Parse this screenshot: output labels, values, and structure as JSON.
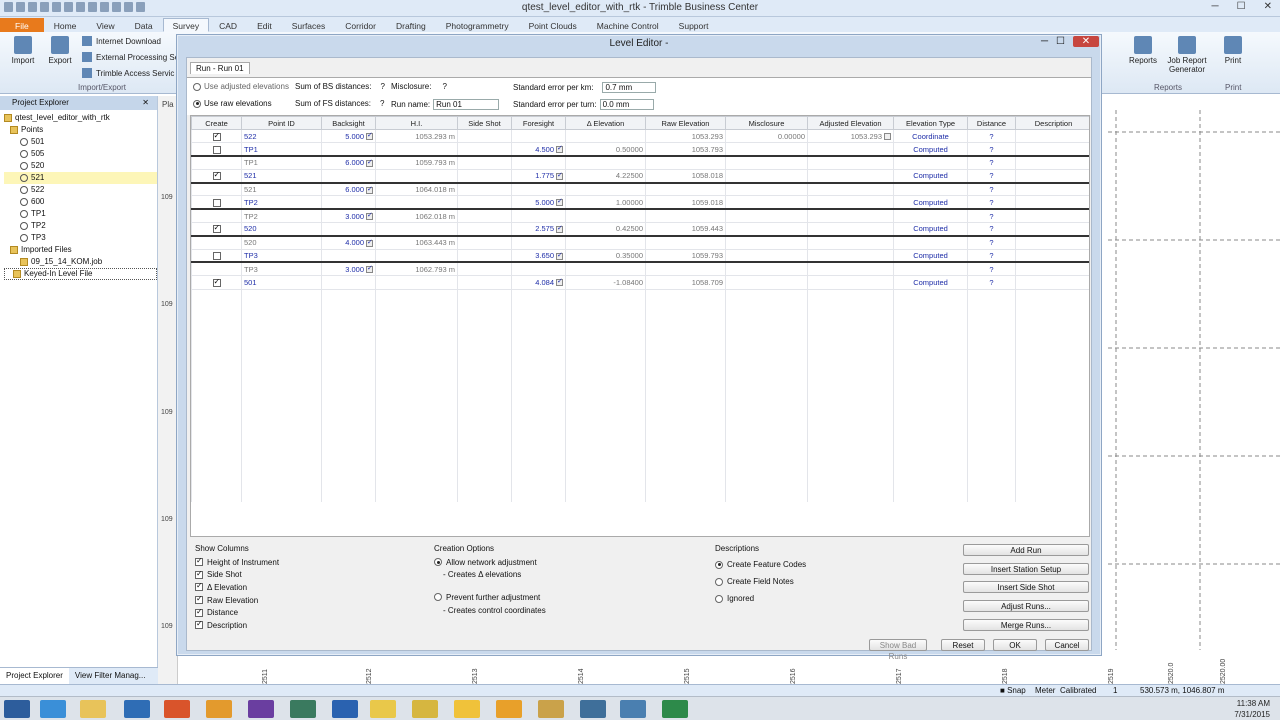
{
  "app": {
    "title": "qtest_level_editor_with_rtk - Trimble Business Center",
    "tabs": [
      "File",
      "Home",
      "View",
      "Data",
      "Survey",
      "CAD",
      "Edit",
      "Surfaces",
      "Corridor",
      "Drafting",
      "Photogrammetry",
      "Point Clouds",
      "Machine Control",
      "Support"
    ],
    "active_tab": "Survey"
  },
  "ribbon": {
    "import": "Import",
    "export": "Export",
    "internet_download": "Internet Download",
    "external_processing": "External Processing Se",
    "trimble_access": "Trimble Access Servic",
    "group_import_export": "Import/Export",
    "reports": "Reports",
    "job_report": "Job Report Generator",
    "group_reports": "Reports",
    "print": "Print",
    "group_print": "Print"
  },
  "explorer": {
    "title": "Project Explorer",
    "root": "qtest_level_editor_with_rtk",
    "points_label": "Points",
    "points": [
      "501",
      "505",
      "520",
      "521",
      "522",
      "600",
      "TP1",
      "TP2",
      "TP3"
    ],
    "selected_point": "521",
    "imported_label": "Imported Files",
    "imported": [
      "09_15_14_KOM.job",
      "Keyed-In Level File"
    ],
    "bottom_tabs": [
      "Project Explorer",
      "View Filter Manag..."
    ]
  },
  "plan": {
    "tab_label": "Pla",
    "left_axis": [
      "109",
      "109",
      "109",
      "109",
      "109"
    ],
    "bottom_axis": [
      "2511",
      "2512",
      "2513",
      "2514",
      "2515",
      "2516",
      "2517",
      "2518",
      "2519"
    ],
    "right_axis": [
      "2520.0",
      "2520.00"
    ]
  },
  "status": {
    "snap": "Snap",
    "units": "Meter",
    "calibrated": "Calibrated",
    "page": "1",
    "coords": "530.573 m, 1046.807 m"
  },
  "taskbar": {
    "time": "11:38 AM",
    "date": "7/31/2015"
  },
  "dialog": {
    "title": "Level Editor -",
    "run_tab": "Run - Run 01",
    "use_adjusted": "Use adjusted elevations",
    "use_raw": "Use raw elevations",
    "sum_bs": "Sum of BS distances:",
    "sum_bs_val": "?",
    "sum_fs": "Sum of FS distances:",
    "sum_fs_val": "?",
    "misclosure_lbl": "Misclosure:",
    "misclosure_val": "?",
    "run_name_lbl": "Run name:",
    "run_name": "Run 01",
    "std_km_lbl": "Standard error per km:",
    "std_km": "0.7 mm",
    "std_turn_lbl": "Standard error per turn:",
    "std_turn": "0.0 mm",
    "columns": [
      "Create",
      "Point ID",
      "Backsight",
      "H.I.",
      "Side Shot",
      "Foresight",
      "Δ Elevation",
      "Raw Elevation",
      "Misclosure",
      "Adjusted Elevation",
      "Elevation Type",
      "Distance",
      "Description"
    ],
    "rows": [
      {
        "create": true,
        "pid": "522",
        "bs": "5.000",
        "hi": "1053.293 m",
        "fs": "",
        "de": "",
        "raw": "1053.293",
        "mis": "0.00000",
        "adj": "1053.293",
        "type": "Coordinate",
        "dist": "?",
        "thick": false,
        "gray": false
      },
      {
        "create": false,
        "pid": "TP1",
        "bs": "",
        "hi": "",
        "fs": "4.500",
        "de": "0.50000",
        "raw": "1053.793",
        "mis": "",
        "adj": "",
        "type": "Computed",
        "dist": "?",
        "thick": true,
        "gray": false
      },
      {
        "create": null,
        "pid": "TP1",
        "bs": "6.000",
        "hi": "1059.793 m",
        "fs": "",
        "de": "",
        "raw": "",
        "mis": "",
        "adj": "",
        "type": "",
        "dist": "?",
        "thick": false,
        "gray": true
      },
      {
        "create": true,
        "pid": "521",
        "bs": "",
        "hi": "",
        "fs": "1.775",
        "de": "4.22500",
        "raw": "1058.018",
        "mis": "",
        "adj": "",
        "type": "Computed",
        "dist": "?",
        "thick": true,
        "gray": false
      },
      {
        "create": null,
        "pid": "521",
        "bs": "6.000",
        "hi": "1064.018 m",
        "fs": "",
        "de": "",
        "raw": "",
        "mis": "",
        "adj": "",
        "type": "",
        "dist": "?",
        "thick": false,
        "gray": true
      },
      {
        "create": false,
        "pid": "TP2",
        "bs": "",
        "hi": "",
        "fs": "5.000",
        "de": "1.00000",
        "raw": "1059.018",
        "mis": "",
        "adj": "",
        "type": "Computed",
        "dist": "?",
        "thick": true,
        "gray": false
      },
      {
        "create": null,
        "pid": "TP2",
        "bs": "3.000",
        "hi": "1062.018 m",
        "fs": "",
        "de": "",
        "raw": "",
        "mis": "",
        "adj": "",
        "type": "",
        "dist": "?",
        "thick": false,
        "gray": true
      },
      {
        "create": true,
        "pid": "520",
        "bs": "",
        "hi": "",
        "fs": "2.575",
        "de": "0.42500",
        "raw": "1059.443",
        "mis": "",
        "adj": "",
        "type": "Computed",
        "dist": "?",
        "thick": true,
        "gray": false
      },
      {
        "create": null,
        "pid": "520",
        "bs": "4.000",
        "hi": "1063.443 m",
        "fs": "",
        "de": "",
        "raw": "",
        "mis": "",
        "adj": "",
        "type": "",
        "dist": "?",
        "thick": false,
        "gray": true
      },
      {
        "create": false,
        "pid": "TP3",
        "bs": "",
        "hi": "",
        "fs": "3.650",
        "de": "0.35000",
        "raw": "1059.793",
        "mis": "",
        "adj": "",
        "type": "Computed",
        "dist": "?",
        "thick": true,
        "gray": false
      },
      {
        "create": null,
        "pid": "TP3",
        "bs": "3.000",
        "hi": "1062.793 m",
        "fs": "",
        "de": "",
        "raw": "",
        "mis": "",
        "adj": "",
        "type": "",
        "dist": "?",
        "thick": false,
        "gray": true
      },
      {
        "create": true,
        "pid": "501",
        "bs": "",
        "hi": "",
        "fs": "4.084",
        "de": "-1.08400",
        "raw": "1058.709",
        "mis": "",
        "adj": "",
        "type": "Computed",
        "dist": "?",
        "thick": false,
        "gray": false
      }
    ],
    "show_columns_title": "Show Columns",
    "show_columns": [
      "Height of Instrument",
      "Side Shot",
      "Δ Elevation",
      "Raw Elevation",
      "Distance",
      "Description"
    ],
    "creation_title": "Creation Options",
    "allow_adj": "Allow network adjustment",
    "allow_adj_sub": "- Creates Δ elevations",
    "prevent_adj": "Prevent further adjustment",
    "prevent_adj_sub": "- Creates control coordinates",
    "desc_title": "Descriptions",
    "desc_opts": [
      "Create Feature Codes",
      "Create Field Notes",
      "Ignored"
    ],
    "buttons": {
      "add_run": "Add Run",
      "insert_station": "Insert Station Setup",
      "insert_side": "Insert Side Shot",
      "adjust_runs": "Adjust Runs...",
      "merge_runs": "Merge Runs...",
      "show_bad": "Show Bad Runs",
      "reset": "Reset",
      "ok": "OK",
      "cancel": "Cancel"
    }
  }
}
